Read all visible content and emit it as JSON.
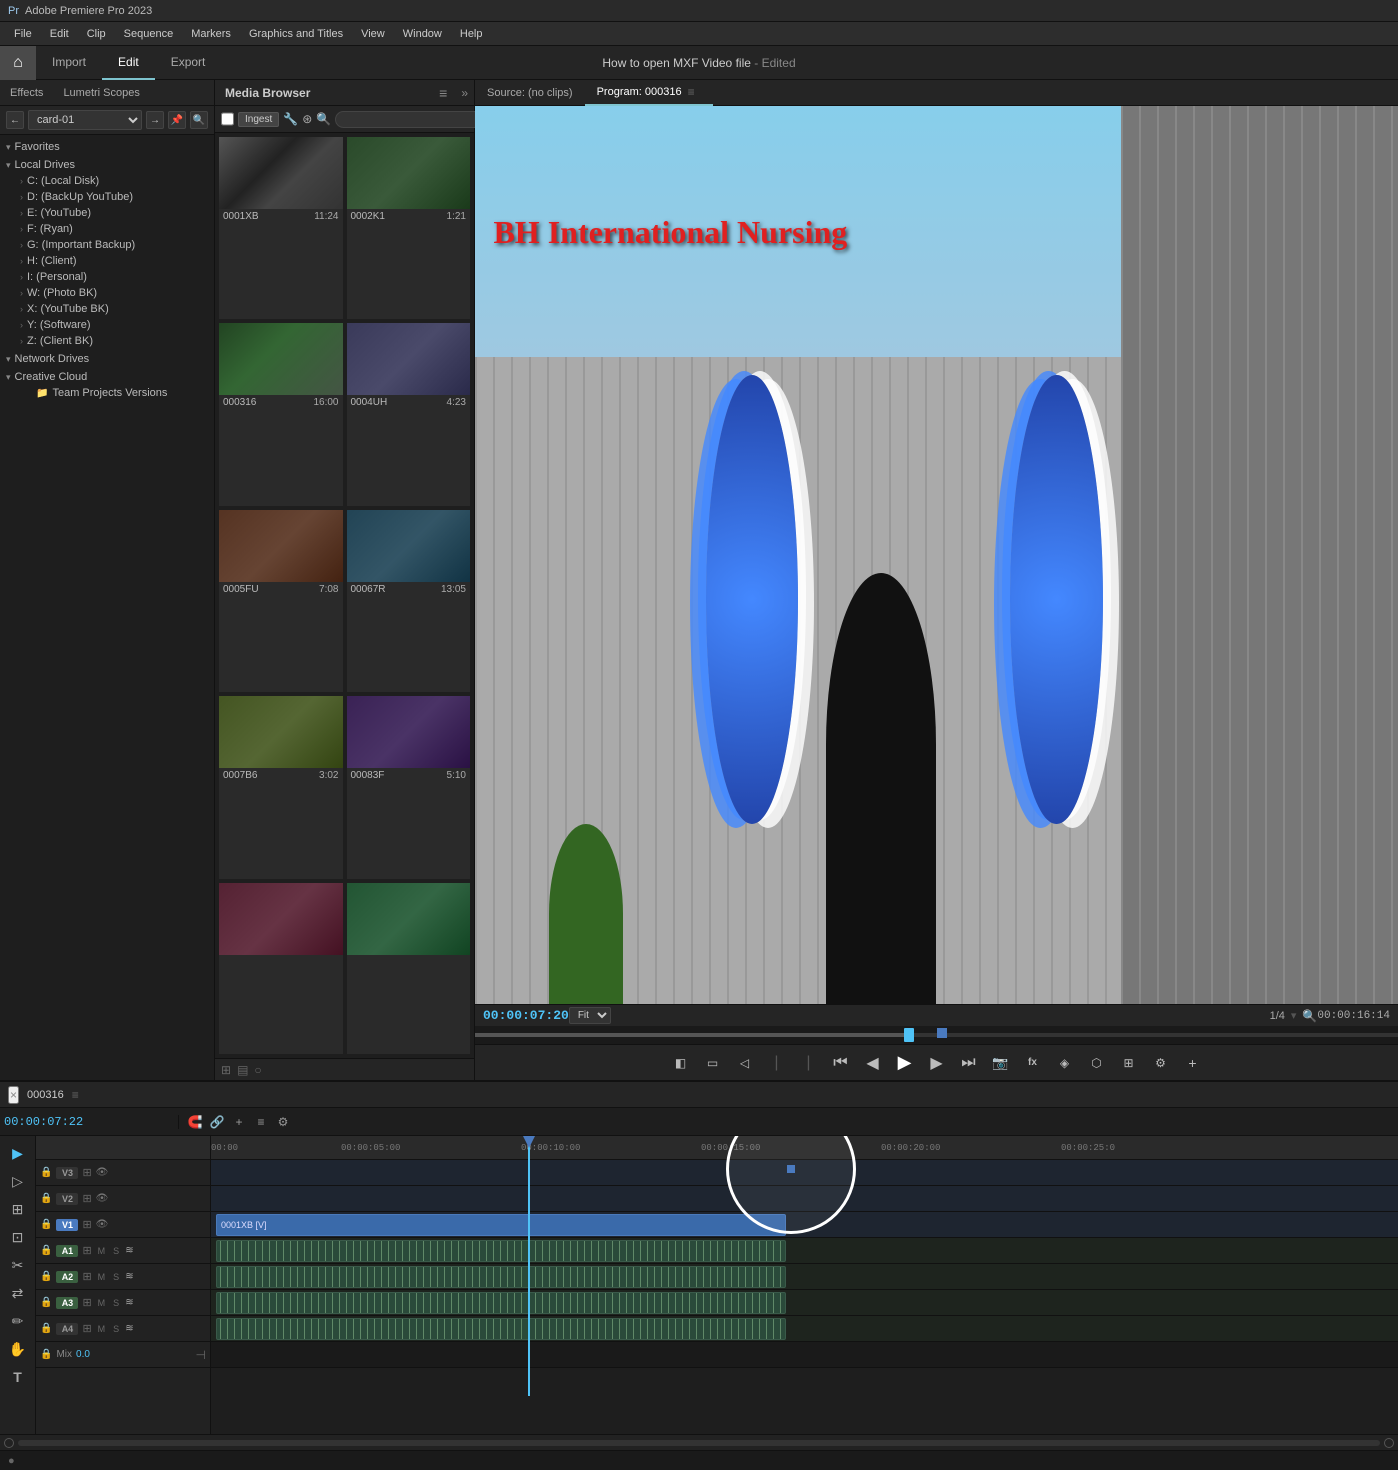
{
  "app": {
    "title": "Adobe Premiere Pro 2023",
    "project": "How to open  MXF Video file",
    "project_status": "- Edited"
  },
  "menu": {
    "items": [
      "File",
      "Edit",
      "Clip",
      "Sequence",
      "Markers",
      "Graphics and Titles",
      "View",
      "Window",
      "Help"
    ]
  },
  "tabs": {
    "home_icon": "⌂",
    "items": [
      "Import",
      "Edit",
      "Export"
    ],
    "active": "Edit"
  },
  "panels": {
    "left_tabs": [
      "Effects",
      "Lumetri Scopes"
    ],
    "favorites_label": "Favorites",
    "local_drives_label": "Local Drives",
    "drives": [
      "C: (Local Disk)",
      "D: (BackUp YouTube)",
      "E: (YouTube)",
      "F: (Ryan)",
      "G: (Important Backup)",
      "H: (Client)",
      "I: (Personal)",
      "W: (Photo BK)",
      "X: (YouTube BK)",
      "Y: (Software)",
      "Z: (Client BK)"
    ],
    "network_label": "Network Drives",
    "cloud_label": "Creative Cloud",
    "team_projects": "Team Projects Versions",
    "card_label": "card-01"
  },
  "media_browser": {
    "tab_label": "Media Browser",
    "ingest_label": "Ingest",
    "search_placeholder": "",
    "thumbnails": [
      {
        "id": "0001XB",
        "duration": "11:24",
        "class": "thumb-0001XB"
      },
      {
        "id": "0002K1",
        "duration": "1:21",
        "class": "thumb-0002K1"
      },
      {
        "id": "000316",
        "duration": "16:00",
        "class": "thumb-000316"
      },
      {
        "id": "0004UH",
        "duration": "4:23",
        "class": "thumb-0004UH"
      },
      {
        "id": "0005FU",
        "duration": "7:08",
        "class": "thumb-0005FU"
      },
      {
        "id": "00067R",
        "duration": "13:05",
        "class": "thumb-00067R"
      },
      {
        "id": "0007B6",
        "duration": "3:02",
        "class": "thumb-0007B6"
      },
      {
        "id": "00083F",
        "duration": "5:10",
        "class": "thumb-00083F"
      },
      {
        "id": "extra1",
        "duration": "",
        "class": "thumb-extra1"
      },
      {
        "id": "extra2",
        "duration": "",
        "class": "thumb-extra2"
      }
    ]
  },
  "source_monitor": {
    "label": "Source: (no clips)"
  },
  "program_monitor": {
    "label": "Program: 000316",
    "time": "00:00:07:20",
    "fit": "Fit",
    "fraction": "1/4",
    "total_time": "00:00:16:14",
    "nursing_text": "BH International Nursing"
  },
  "timeline": {
    "name": "000316",
    "current_time": "00:00:07:22",
    "ruler_marks": [
      "00:00",
      "00:00:05:00",
      "00:00:10:00",
      "00:00:15:00",
      "00:00:20:00",
      "00:00:25:0"
    ],
    "tracks": [
      {
        "id": "V3",
        "type": "video",
        "label": "V3"
      },
      {
        "id": "V2",
        "type": "video",
        "label": "V2"
      },
      {
        "id": "V1",
        "type": "video",
        "label": "V1",
        "active": true
      },
      {
        "id": "A1",
        "type": "audio",
        "label": "A1"
      },
      {
        "id": "A2",
        "type": "audio",
        "label": "A2"
      },
      {
        "id": "A3",
        "type": "audio",
        "label": "A3"
      },
      {
        "id": "A4",
        "type": "audio",
        "label": "A4"
      }
    ],
    "clip_label": "0001XB [V]",
    "mix_label": "Mix",
    "mix_value": "0.0"
  },
  "icons": {
    "play": "▶",
    "pause": "⏸",
    "stop": "⏹",
    "step_back": "◀◀",
    "step_fwd": "▶▶",
    "rewind": "⏮",
    "ff": "⏭",
    "camera": "📷",
    "fx": "fx",
    "marker": "◆",
    "lock": "🔒",
    "eye": "👁",
    "speaker": "♪",
    "wave": "≋",
    "wrench": "🔧",
    "pen": "✏",
    "gear": "⚙",
    "search": "🔍",
    "plus": "+",
    "minus": "−",
    "menu": "≡",
    "arrow_left": "←",
    "arrow_right": "→",
    "close": "×",
    "expand": "»",
    "chevron_right": "›",
    "chevron_down": "▾",
    "triangle_right": "▶"
  }
}
